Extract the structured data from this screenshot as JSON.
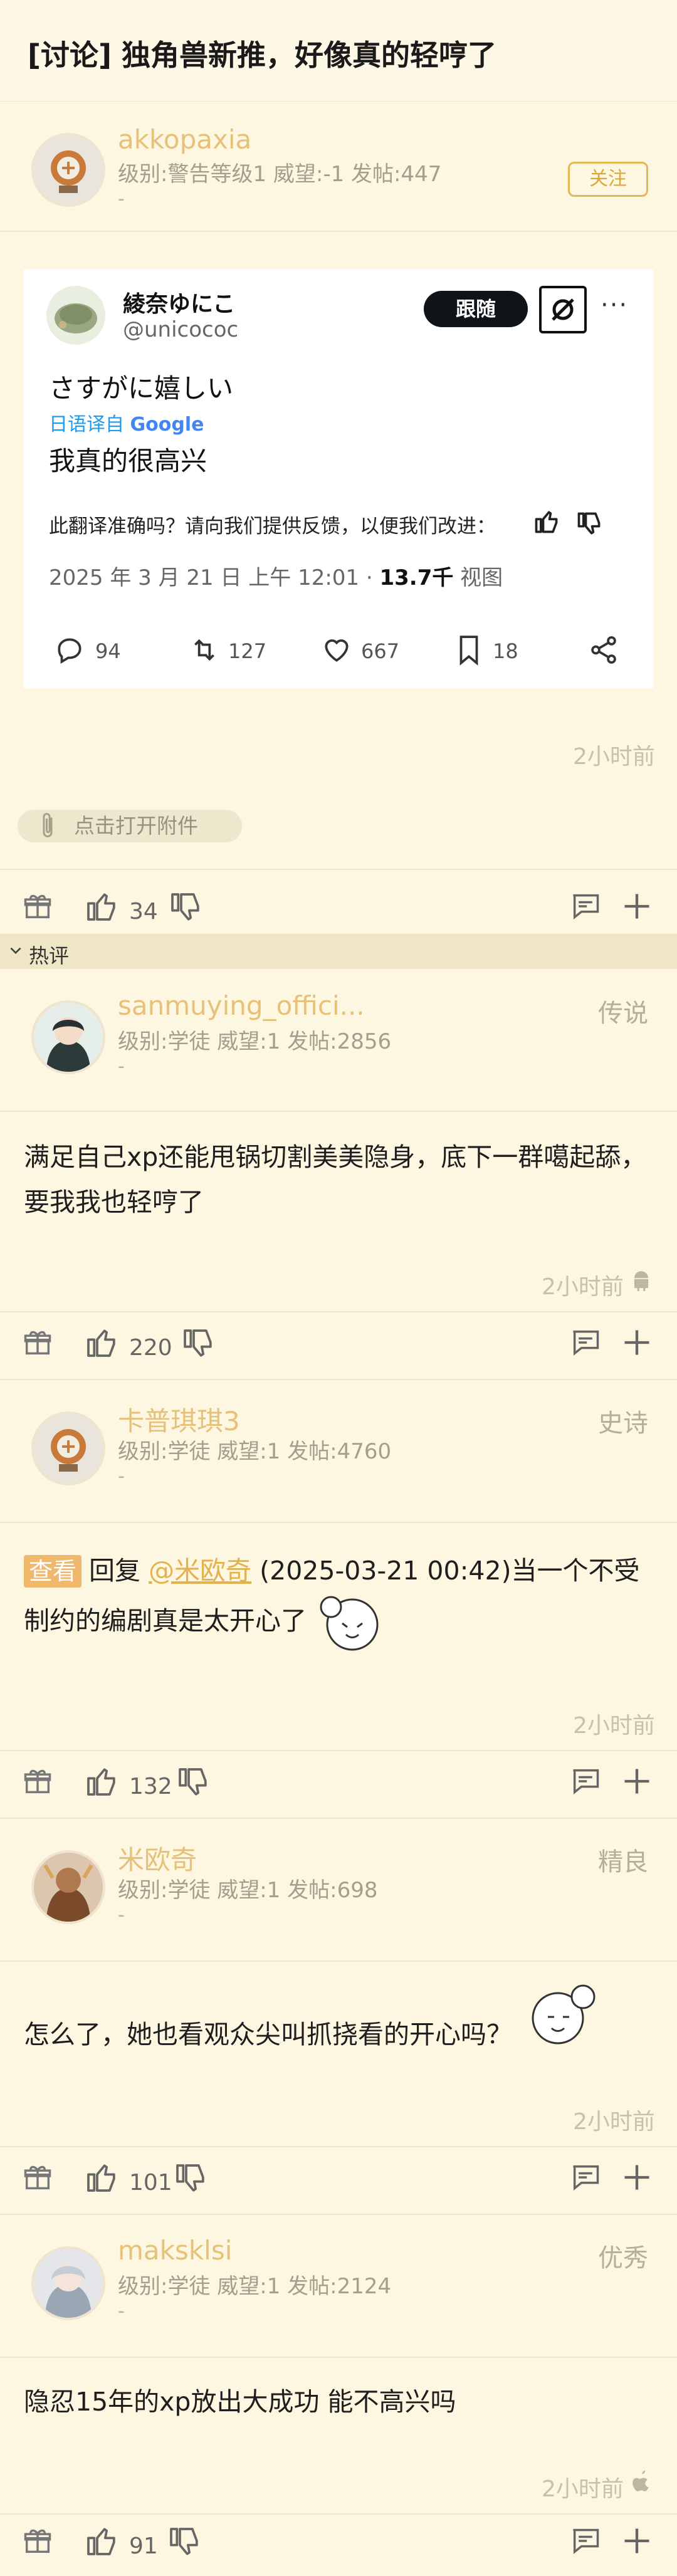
{
  "header": {
    "title": "[讨论] 独角兽新推，好像真的轻哼了"
  },
  "op": {
    "username": "akkopaxia",
    "meta": "级别:警告等级1 威望:-1 发帖:447",
    "dash": "-",
    "follow_label": "关注",
    "time": "2小时前",
    "attachment_label": "点击打开附件",
    "likes": "34"
  },
  "tweet": {
    "display_name": "綾奈ゆにこ",
    "handle": "@unicococ",
    "follow_label": "跟随",
    "text_ja": "さすがに嬉しい",
    "translated_prefix": "日语译自",
    "translated_brand": "Google",
    "text_zh": "我真的很高兴",
    "feedback": "此翻译准确吗？请向我们提供反馈，以便我们改进：",
    "date": "2025 年 3 月 21 日 上午 12:01 · ",
    "views_num": "13.7千",
    "views_label": " 视图",
    "stats": {
      "replies": "94",
      "retweets": "127",
      "likes": "667",
      "bookmarks": "18"
    }
  },
  "hot_label": "热评",
  "comments": [
    {
      "username": "sanmuying_offici...",
      "meta": "级别:学徒 威望:1 发帖:2856",
      "rank": "传说",
      "dash": "-",
      "text": "满足自己xp还能甩锅切割美美隐身，底下一群噶起舔，要我我也轻哼了",
      "time": "2小时前",
      "likes": "220"
    },
    {
      "username": "卡普琪琪3",
      "meta": "级别:学徒 威望:1 发帖:4760",
      "rank": "史诗",
      "dash": "-",
      "tag": "查看",
      "reply_prefix": "回复",
      "mention": "@米欧奇",
      "reply_rest": "(2025-03-21 00:42)当一个不受制约的编剧真是太开心了",
      "time": "2小时前",
      "likes": "132"
    },
    {
      "username": "米欧奇",
      "meta": "级别:学徒 威望:1 发帖:698",
      "rank": "精良",
      "dash": "-",
      "text": "怎么了，她也看观众尖叫抓挠看的开心吗？",
      "time": "2小时前",
      "likes": "101"
    },
    {
      "username": "maksklsi",
      "meta": "级别:学徒 威望:1 发帖:2124",
      "rank": "优秀",
      "dash": "-",
      "text": "隐忍15年的xp放出大成功 能不高兴吗",
      "time": "2小时前",
      "likes": "91"
    }
  ]
}
